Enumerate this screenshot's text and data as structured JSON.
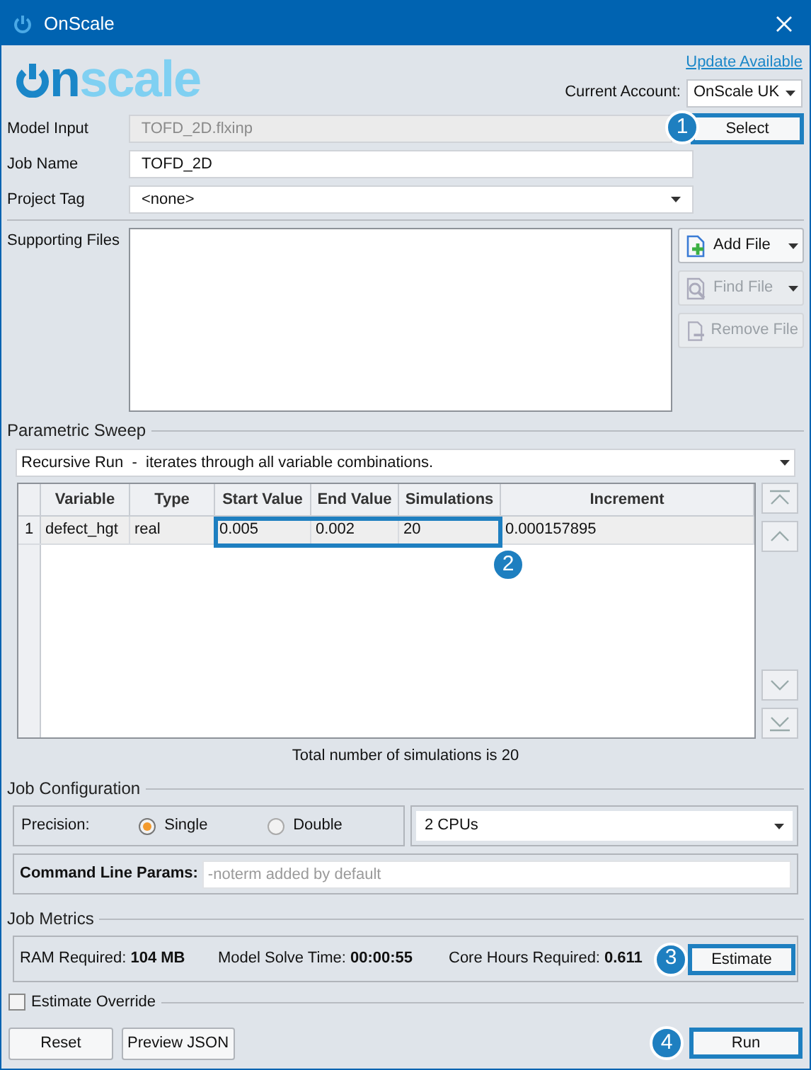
{
  "window": {
    "title": "OnScale"
  },
  "logo": {
    "part_1": "n",
    "part_2": "scale"
  },
  "update_link": "Update Available",
  "account": {
    "label": "Current Account:",
    "value": "OnScale UK"
  },
  "model_input": {
    "label": "Model Input",
    "value": "TOFD_2D.flxinp",
    "disabled": true,
    "button": "Select"
  },
  "job_name": {
    "label": "Job Name",
    "value": "TOFD_2D"
  },
  "project_tag": {
    "label": "Project Tag",
    "value": "<none>"
  },
  "supporting_files": {
    "label": "Supporting Files",
    "buttons": [
      {
        "label": "Add File",
        "kind": "add",
        "disabled": false,
        "dropdown": true
      },
      {
        "label": "Find File",
        "kind": "find",
        "disabled": true,
        "dropdown": true
      },
      {
        "label": "Remove File",
        "kind": "remove",
        "disabled": true,
        "dropdown": false
      }
    ]
  },
  "parametric_sweep": {
    "title": "Parametric Sweep",
    "mode": "Recursive Run  -  iterates through all variable combinations.",
    "table": {
      "columns": [
        "Variable",
        "Type",
        "Start Value",
        "End Value",
        "Simulations",
        "Increment"
      ],
      "rows": [
        {
          "index": "1",
          "cells": [
            "defect_hgt",
            "real",
            "0.005",
            "0.002",
            "20",
            "0.000157895"
          ],
          "selected": true
        }
      ]
    },
    "total": "Total number of simulations is 20"
  },
  "job_configuration": {
    "title": "Job Configuration",
    "precision_label": "Precision:",
    "precision_options": [
      {
        "label": "Single",
        "selected": true
      },
      {
        "label": "Double",
        "selected": false
      }
    ],
    "cpus": "2 CPUs",
    "command_line_label": "Command Line Params:",
    "command_line_placeholder": "-noterm added by default"
  },
  "job_metrics": {
    "title": "Job Metrics",
    "items": [
      {
        "label": "RAM Required:",
        "value": "104 MB"
      },
      {
        "label": "Model Solve Time:",
        "value": "00:00:55"
      },
      {
        "label": "Core Hours Required:",
        "value": "0.611"
      }
    ],
    "button": "Estimate"
  },
  "estimate_override": {
    "label": "Estimate Override",
    "checked": false
  },
  "footer_buttons": [
    "Reset",
    "Preview JSON"
  ],
  "run_button": "Run",
  "callouts": [
    "1",
    "2",
    "3",
    "4"
  ]
}
